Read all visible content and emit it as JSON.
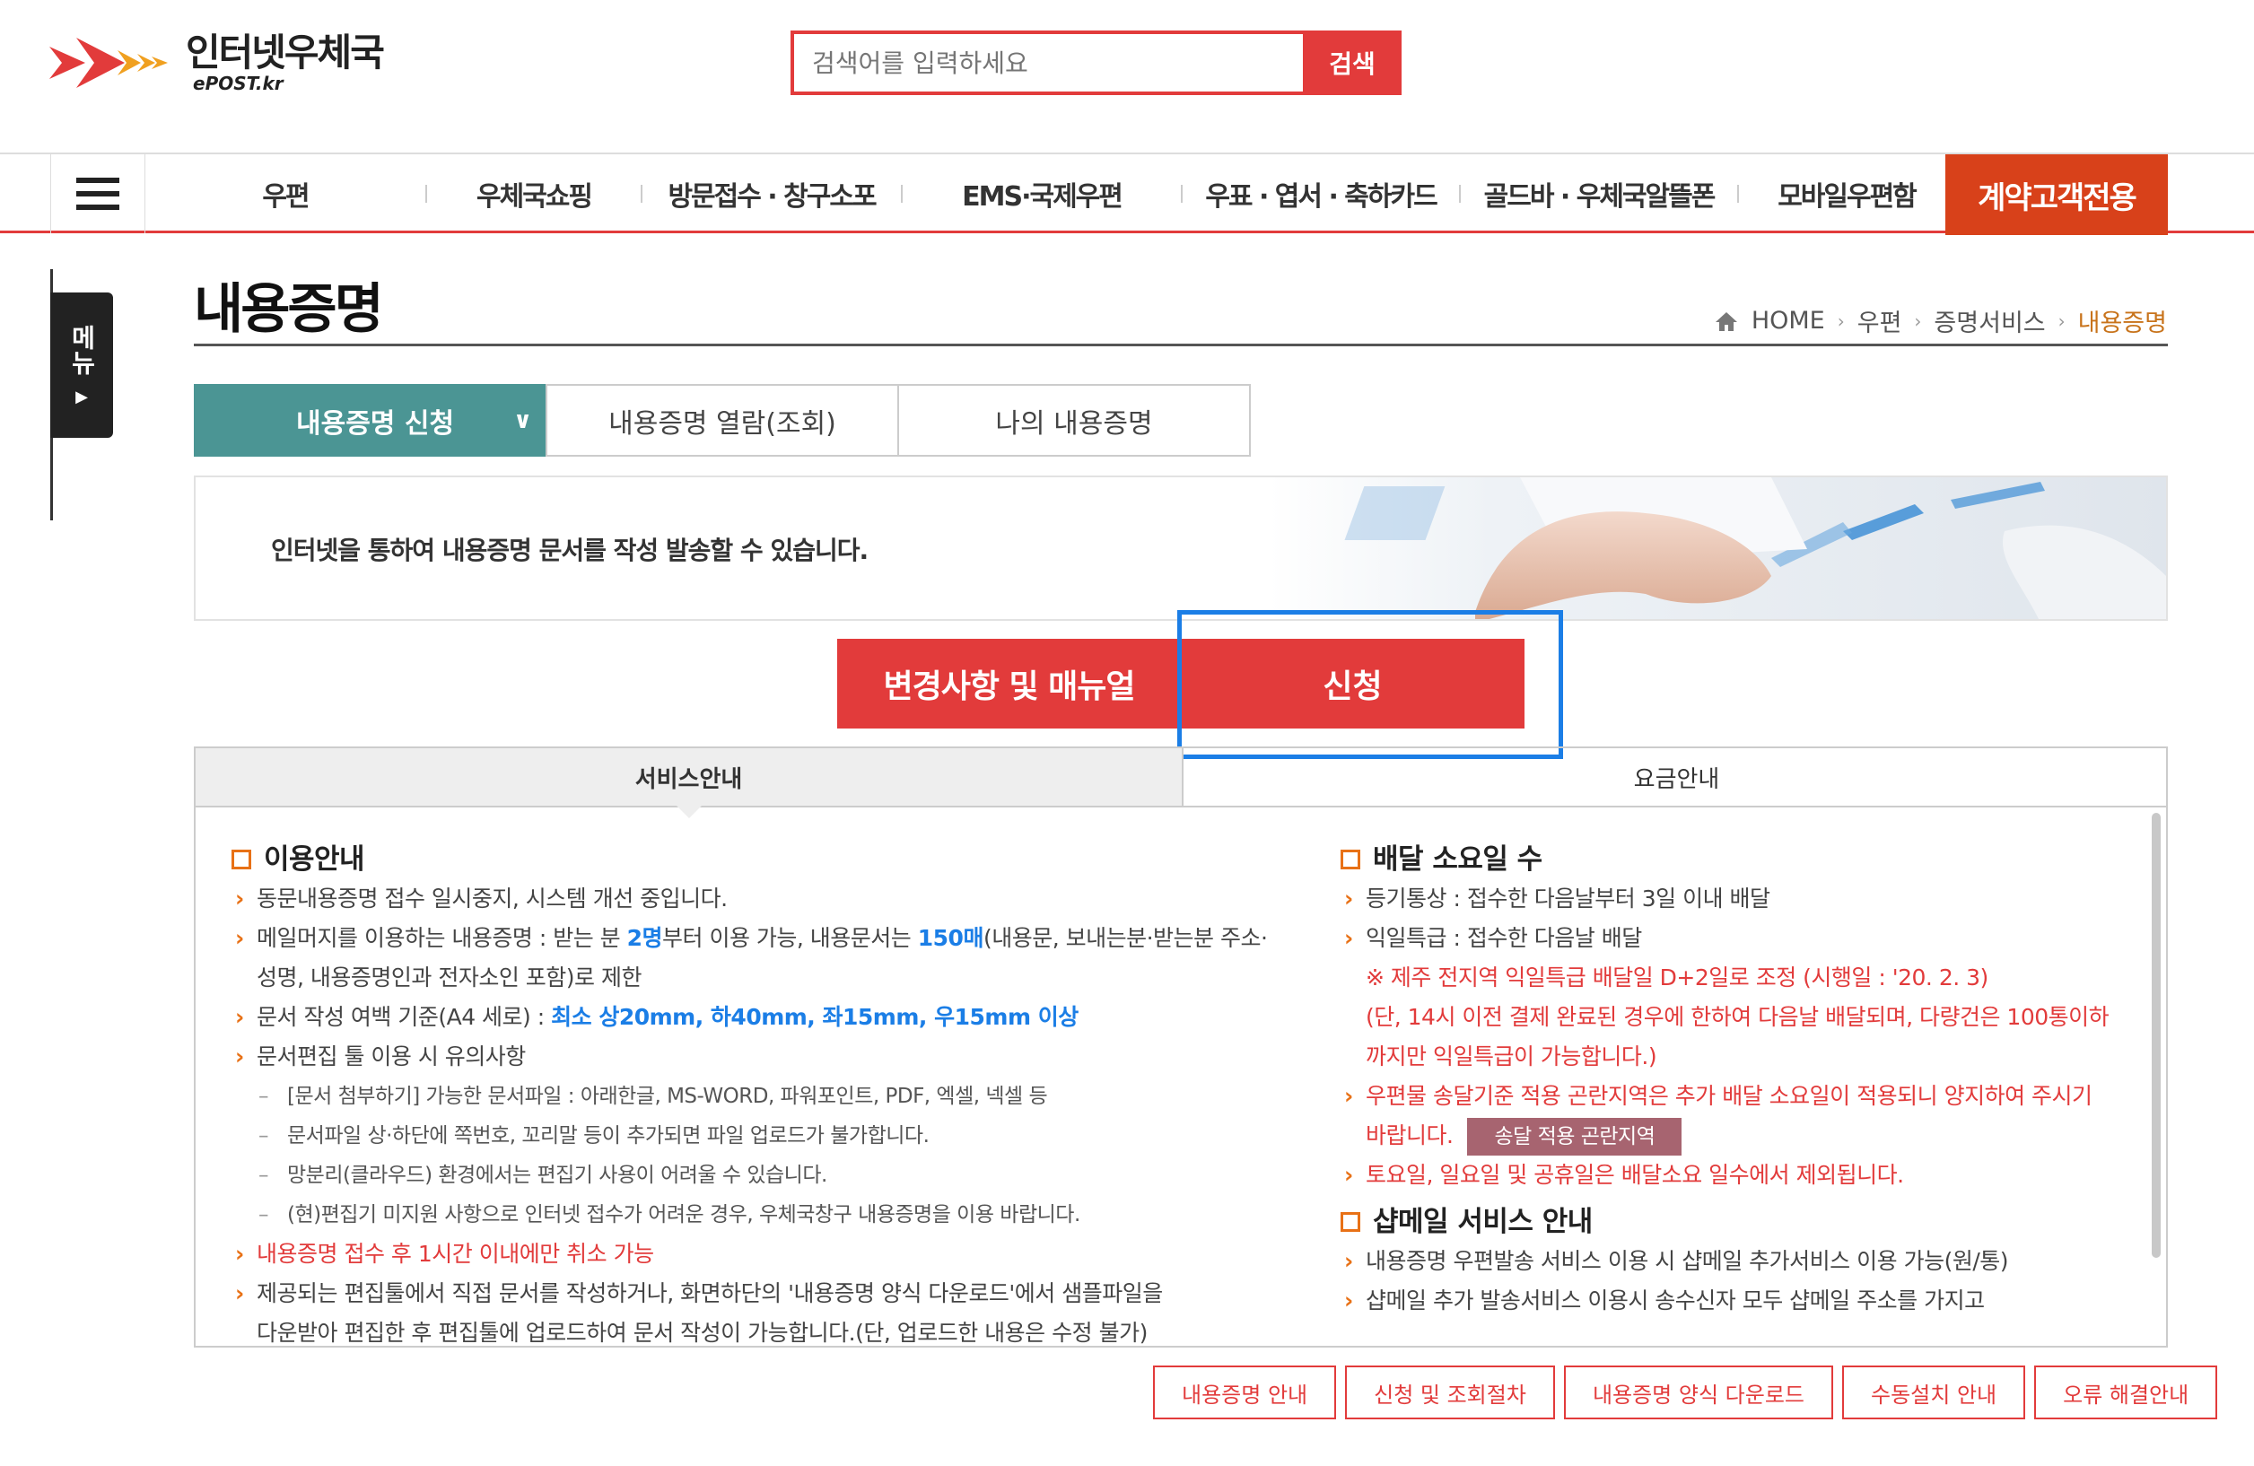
{
  "header": {
    "logo_text": "인터넷우체국",
    "logo_sub": "ePOST.kr",
    "search_placeholder": "검색어를 입력하세요",
    "search_button": "검색"
  },
  "nav": {
    "items": [
      "우편",
      "우체국쇼핑",
      "방문접수 · 창구소포",
      "EMS·국제우편",
      "우표 · 엽서 · 축하카드",
      "골드바 · 우체국알뜰폰",
      "모바일우편함"
    ],
    "special": "계약고객전용"
  },
  "side_menu": {
    "label": "메뉴"
  },
  "page": {
    "title": "내용증명",
    "breadcrumb": [
      "HOME",
      "우편",
      "증명서비스",
      "내용증명"
    ]
  },
  "tabs": [
    "내용증명 신청",
    "내용증명 열람(조회)",
    "나의 내용증명"
  ],
  "banner": {
    "text": "인터넷을 통하여 내용증명 문서를 작성 발송할 수 있습니다."
  },
  "actions": {
    "manual": "변경사항 및 매뉴얼",
    "apply": "신청"
  },
  "info_tabs": [
    "서비스안내",
    "요금안내"
  ],
  "left": {
    "heading": "이용안내",
    "l1": "동문내용증명 접수 일시중지, 시스템 개선 중입니다.",
    "l2a": "메일머지를 이용하는 내용증명 : 받는 분 ",
    "l2b": "2명",
    "l2c": "부터 이용 가능, 내용문서는 ",
    "l2d": "150매",
    "l2e": "(내용문, 보내는분·받는분 주소·",
    "l2f": "성명, 내용증명인과 전자소인 포함)로 제한",
    "l3a": "문서 작성 여백 기준(A4 세로) : ",
    "l3b": "최소 상20mm, 하40mm, 좌15mm, 우15mm 이상",
    "l4": "문서편집 툴 이용 시 유의사항",
    "s1": "[문서 첨부하기] 가능한 문서파일 : 아래한글, MS-WORD, 파워포인트, PDF, 엑셀, 넥셀 등",
    "s2": "문서파일 상·하단에 쪽번호, 꼬리말 등이 추가되면 파일 업로드가 불가합니다.",
    "s3": "망분리(클라우드) 환경에서는 편집기 사용이 어려울 수 있습니다.",
    "s4": "(현)편집기 미지원 사항으로 인터넷 접수가 어려운 경우, 우체국창구 내용증명을 이용 바랍니다.",
    "l5": "내용증명 접수 후 1시간 이내에만 취소 가능",
    "l6a": "제공되는 편집툴에서 직접 문서를 작성하거나, 화면하단의 '내용증명 양식 다운로드'에서 샘플파일을",
    "l6b": "다운받아 편집한 후 편집툴에 업로드하여 문서 작성이 가능합니다.(단, 업로드한 내용은 수정 불가)"
  },
  "right": {
    "heading1": "배달 소요일 수",
    "r1": "등기통상 : 접수한 다음날부터 3일 이내 배달",
    "r2": "익일특급 : 접수한 다음날 배달",
    "r3": "※ 제주 전지역 익일특급 배달일 D+2일로 조정 (시행일 : '20. 2. 3)",
    "r4": "(단, 14시 이전 결제 완료된 경우에 한하여 다음날 배달되며, 다량건은 100통이하",
    "r5": "까지만 익일특급이 가능합니다.)",
    "r6": "우편물 송달기준 적용 곤란지역은 추가 배달 소요일이 적용되니 양지하여 주시기",
    "r7": "바랍니다.",
    "badge": "송달 적용 곤란지역",
    "r8": "토요일, 일요일 및 공휴일은 배달소요 일수에서 제외됩니다.",
    "heading2": "샵메일 서비스 안내",
    "r9": "내용증명 우편발송 서비스 이용 시 샵메일 추가서비스 이용 가능(원/통)",
    "r10": "샵메일 추가 발송서비스 이용시 송수신자 모두 샵메일 주소를 가지고"
  },
  "bottom_buttons": [
    "내용증명 안내",
    "신청 및 조회절차",
    "내용증명 양식 다운로드",
    "수동설치 안내",
    "오류 해결안내"
  ],
  "colors": {
    "brand_red": "#e23b3b",
    "tab_teal": "#4b9594",
    "special_orange": "#d8411a",
    "focus_blue": "#1b7ee6"
  }
}
